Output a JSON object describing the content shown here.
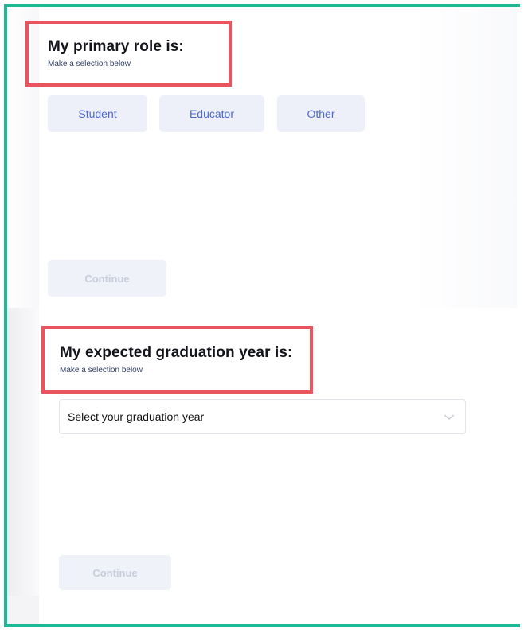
{
  "role_section": {
    "title": "My primary role is:",
    "subtitle": "Make a selection below",
    "options": [
      "Student",
      "Educator",
      "Other"
    ],
    "continue_label": "Continue"
  },
  "graduation_section": {
    "title": "My expected graduation year is:",
    "subtitle": "Make a selection below",
    "select_value": "Select your graduation year",
    "select_icon": "chevron-down-icon",
    "continue_label": "Continue"
  },
  "colors": {
    "frame_border": "#1db994",
    "highlight_box": "#e9545f",
    "option_bg": "#eef0f9",
    "option_text": "#4e69c8",
    "disabled_text": "#c8cddb"
  }
}
